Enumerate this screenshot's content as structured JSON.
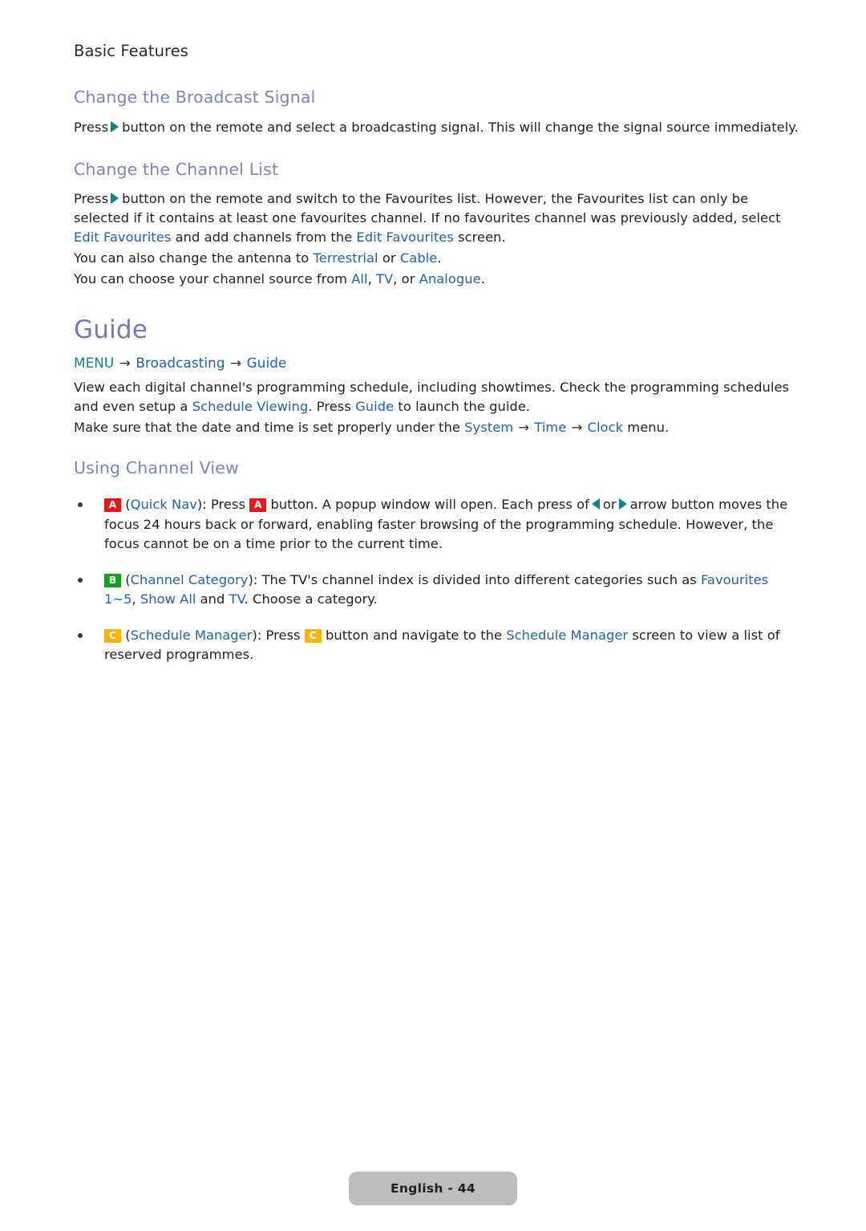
{
  "document": {
    "running_head": "Basic Features",
    "page_label": "English - 44"
  },
  "colors": {
    "heading": "#7b85c4",
    "h1": "#6f79bb",
    "link_term": "#1d63ad",
    "menu_term": "#0e7f93",
    "arrow_glyph": "#11808f",
    "key_a": "#e8161a",
    "key_b": "#16a01b",
    "key_c": "#f5b30c",
    "page_pill_bg": "#bdbdbd",
    "body_text": "#222222"
  },
  "sections": {
    "broadcast_signal": {
      "heading": "Change the Broadcast Signal",
      "paragraph": {
        "pre": "Press",
        "post": "button on the remote and select a broadcasting signal. This will change the signal source immediately."
      }
    },
    "channel_list": {
      "heading": "Change the Channel List",
      "paragraph_1": {
        "pre": "Press",
        "part_1": "button on the remote and switch to the Favourites list. However, the Favourites list can only be selected if it contains at least one favourites channel. If no favourites channel was previously added, select",
        "term_1": "Edit Favourites",
        "part_2": "and add channels from the",
        "term_2": "Edit Favourites",
        "part_3": "screen."
      },
      "paragraph_2": {
        "part_1": "You can also change the antenna to",
        "term_1": "Terrestrial",
        "part_2": "or",
        "term_2": "Cable",
        "part_3": "."
      },
      "paragraph_3": {
        "part_1": "You can choose your channel source from",
        "term_1": "All",
        "sep_1": ",",
        "term_2": "TV",
        "part_2": ", or",
        "term_3": "Analogue",
        "part_3": "."
      }
    },
    "guide": {
      "heading": "Guide",
      "menu_path": {
        "root": "MENU",
        "arrow": "→",
        "level_1": "Broadcasting",
        "level_2": "Guide"
      },
      "paragraph_1": {
        "part_1": "View each digital channel's programming schedule, including showtimes. Check the programming schedules and even setup a",
        "term_1": "Schedule Viewing",
        "part_2": ". Press",
        "term_2": "Guide",
        "part_3": "to launch the guide."
      },
      "paragraph_2": {
        "part_1": "Make sure that the date and time is set properly under the",
        "term_1": "System",
        "arrow_1": "→",
        "term_2": "Time",
        "arrow_2": "→",
        "term_3": "Clock",
        "part_2": "menu."
      }
    },
    "channel_view": {
      "heading": "Using Channel View",
      "bullets": [
        {
          "key": "A",
          "key_color": "#e8161a",
          "open_paren": "(",
          "term_title": "Quick Nav",
          "close_paren": "): Press",
          "inline_key": "A",
          "part_1": "button. A popup window will open. Each press of",
          "part_2": "or",
          "part_3": "arrow button moves the focus 24 hours back or forward, enabling faster browsing of the programming schedule. However, the focus cannot be on a time prior to the current time."
        },
        {
          "key": "B",
          "key_color": "#16a01b",
          "open_paren": "(",
          "term_title": "Channel Category",
          "close_paren": "): The TV's channel index is divided into different categories such as",
          "term_1": "Favourites 1~5",
          "sep_1": ",",
          "term_2": "Show All",
          "part_1": "and",
          "term_3": "TV",
          "part_2": ". Choose a category."
        },
        {
          "key": "C",
          "key_color": "#f5b30c",
          "open_paren": "(",
          "term_title": "Schedule Manager",
          "close_paren": "): Press",
          "inline_key": "C",
          "part_1": "button and navigate to the",
          "term_1": "Schedule Manager",
          "part_2": "screen to view a list of reserved programmes."
        }
      ]
    }
  }
}
